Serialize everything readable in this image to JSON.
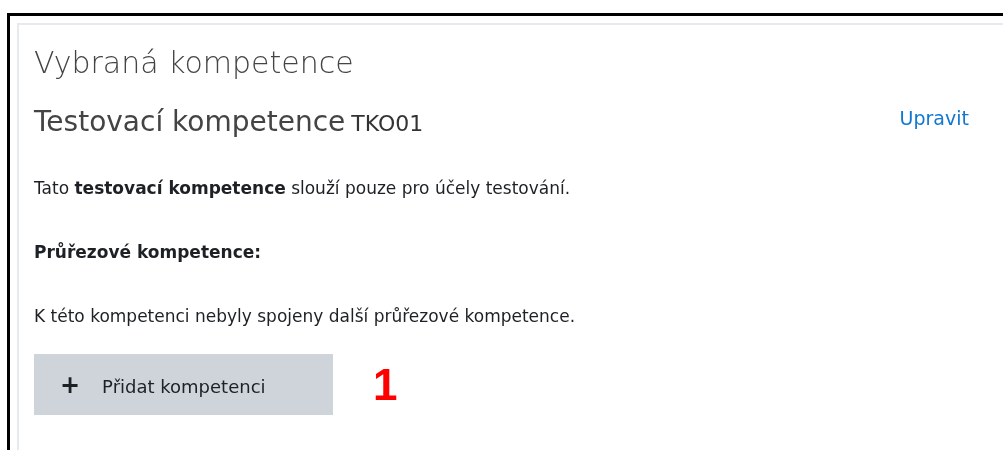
{
  "section_title": "Vybraná kompetence",
  "competency": {
    "name": "Testovací kompetence",
    "code": "TKO01",
    "edit_link": "Upravit",
    "description": "Tato **testovací kompetence** slouží pouze pro účely testování."
  },
  "cross_competencies": {
    "heading": "Průřezové kompetence:",
    "empty_message": "K této kompetenci nebyly spojeny další průřezové kompetence."
  },
  "add_button": {
    "icon": "+",
    "label": "Přidat kompetenci"
  },
  "annotation": "1"
}
